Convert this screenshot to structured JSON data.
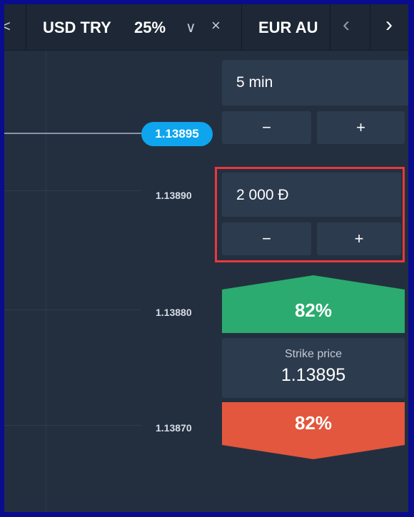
{
  "topbar": {
    "asset_left_glyph": "<",
    "asset_name": "USD TRY",
    "asset_payout": "25%",
    "chevron_glyph": "∨",
    "close_glyph": "×",
    "next_asset_name": "EUR AU",
    "scroll_prev_glyph": "‹",
    "scroll_next_glyph": "›"
  },
  "chart": {
    "current_price": "1.13895",
    "price_ticks": [
      "1.13890",
      "1.13880",
      "1.13870"
    ]
  },
  "trade_panel": {
    "duration": "5 min",
    "duration_minus": "−",
    "duration_plus": "+",
    "amount": "2 000  Đ",
    "amount_minus": "−",
    "amount_plus": "+",
    "call_payout": "82%",
    "strike_label": "Strike price",
    "strike_value": "1.13895",
    "put_payout": "82%"
  },
  "colors": {
    "call": "#2bab6f",
    "put": "#e2573d",
    "current_price_badge": "#0ea5ee",
    "highlight_border": "#e8383d"
  }
}
